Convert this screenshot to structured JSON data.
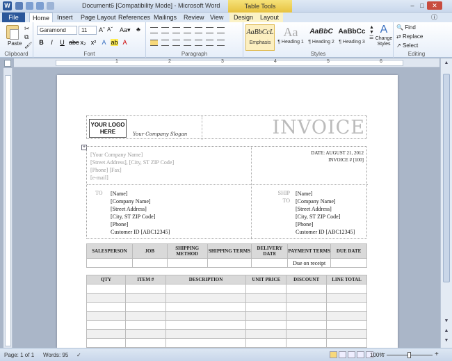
{
  "titlebar": {
    "title": "Document6 [Compatibility Mode] - Microsoft Word",
    "contextual": "Table Tools",
    "app_letter": "W"
  },
  "tabs": [
    "File",
    "Home",
    "Insert",
    "Page Layout",
    "References",
    "Mailings",
    "Review",
    "View",
    "Design",
    "Layout"
  ],
  "ribbon": {
    "clipboard": {
      "paste": "Paste",
      "label": "Clipboard"
    },
    "font": {
      "name": "Garamond",
      "size": "11",
      "label": "Font"
    },
    "paragraph": {
      "label": "Paragraph"
    },
    "styles": {
      "label": "Styles",
      "items": [
        {
          "sample": "AaBbCcL",
          "name": "Emphasis"
        },
        {
          "sample": "Aa",
          "name": "¶ Heading 1"
        },
        {
          "sample": "AaBbC",
          "name": "¶ Heading 2"
        },
        {
          "sample": "AaBbCc",
          "name": "¶ Heading 3"
        }
      ],
      "change": "Change Styles"
    },
    "editing": {
      "find": "Find",
      "replace": "Replace",
      "select": "Select",
      "label": "Editing"
    }
  },
  "ruler": [
    "1",
    "2",
    "3",
    "4",
    "5",
    "6"
  ],
  "doc": {
    "logo": "YOUR LOGO HERE",
    "slogan": "Your Company Slogan",
    "invoice_title": "INVOICE",
    "company_lines": [
      "[Your Company Name]",
      "[Street Address], [City, ST  ZIP Code]",
      "[Phone]  [Fax]",
      "[e-mail]"
    ],
    "date_line": "DATE: AUGUST 21, 2012",
    "invoice_line": "INVOICE  # [100]",
    "to_label": "TO",
    "ship_label": "SHIP",
    "ship_to_label": "TO",
    "to_lines": [
      "[Name]",
      "[Company Name]",
      "[Street Address]",
      "[City, ST  ZIP Code]",
      "[Phone]",
      "Customer ID [ABC12345]"
    ],
    "ship_lines": [
      "[Name]",
      "[Company Name]",
      "[Street Address]",
      "[City, ST  ZIP Code]",
      "[Phone]",
      "Customer ID [ABC12345]"
    ],
    "sales_headers": [
      "SALESPERSON",
      "JOB",
      "SHIPPING METHOD",
      "SHIPPING TERMS",
      "DELIVERY DATE",
      "PAYMENT TERMS",
      "DUE DATE"
    ],
    "sales_row": [
      "",
      "",
      "",
      "",
      "",
      "Due on receipt",
      ""
    ],
    "line_headers": [
      "QTY",
      "ITEM #",
      "DESCRIPTION",
      "UNIT PRICE",
      "DISCOUNT",
      "LINE TOTAL"
    ]
  },
  "status": {
    "page": "Page: 1 of 1",
    "words": "Words: 95",
    "zoom": "100%"
  }
}
